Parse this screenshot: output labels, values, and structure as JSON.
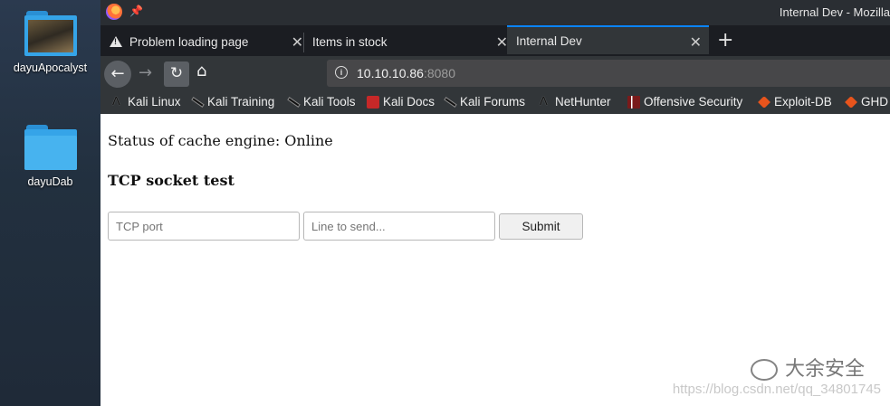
{
  "desktop": {
    "items": [
      {
        "label": "dayuApocalyst"
      },
      {
        "label": "dayuDab"
      }
    ]
  },
  "window": {
    "title": "Internal Dev - Mozilla"
  },
  "tabs": [
    {
      "label": "Problem loading page",
      "icon": "warning-icon"
    },
    {
      "label": "Items in stock"
    },
    {
      "label": "Internal Dev",
      "active": true
    }
  ],
  "nav": {
    "url_host": "10.10.10.86",
    "url_port": ":8080"
  },
  "bookmarks": [
    {
      "label": "Kali Linux",
      "icon": "kali-icon"
    },
    {
      "label": "Kali Training",
      "icon": "kali-dragon-icon"
    },
    {
      "label": "Kali Tools",
      "icon": "kali-dragon-icon"
    },
    {
      "label": "Kali Docs",
      "icon": "kali-docs-icon"
    },
    {
      "label": "Kali Forums",
      "icon": "kali-dragon-icon"
    },
    {
      "label": "NetHunter",
      "icon": "nethunter-icon"
    },
    {
      "label": "Offensive Security",
      "icon": "offsec-icon"
    },
    {
      "label": "Exploit-DB",
      "icon": "exploit-db-icon"
    },
    {
      "label": "GHD",
      "icon": "ghdb-icon"
    }
  ],
  "page": {
    "status": "Status of cache engine: Online",
    "section_title": "TCP socket test",
    "port_placeholder": "TCP port",
    "line_placeholder": "Line to send...",
    "submit_label": "Submit"
  },
  "watermark": {
    "brand": "大余安全",
    "url": "https://blog.csdn.net/qq_34801745"
  },
  "colors": {
    "accent": "#0a84ff",
    "chrome": "#323639"
  }
}
